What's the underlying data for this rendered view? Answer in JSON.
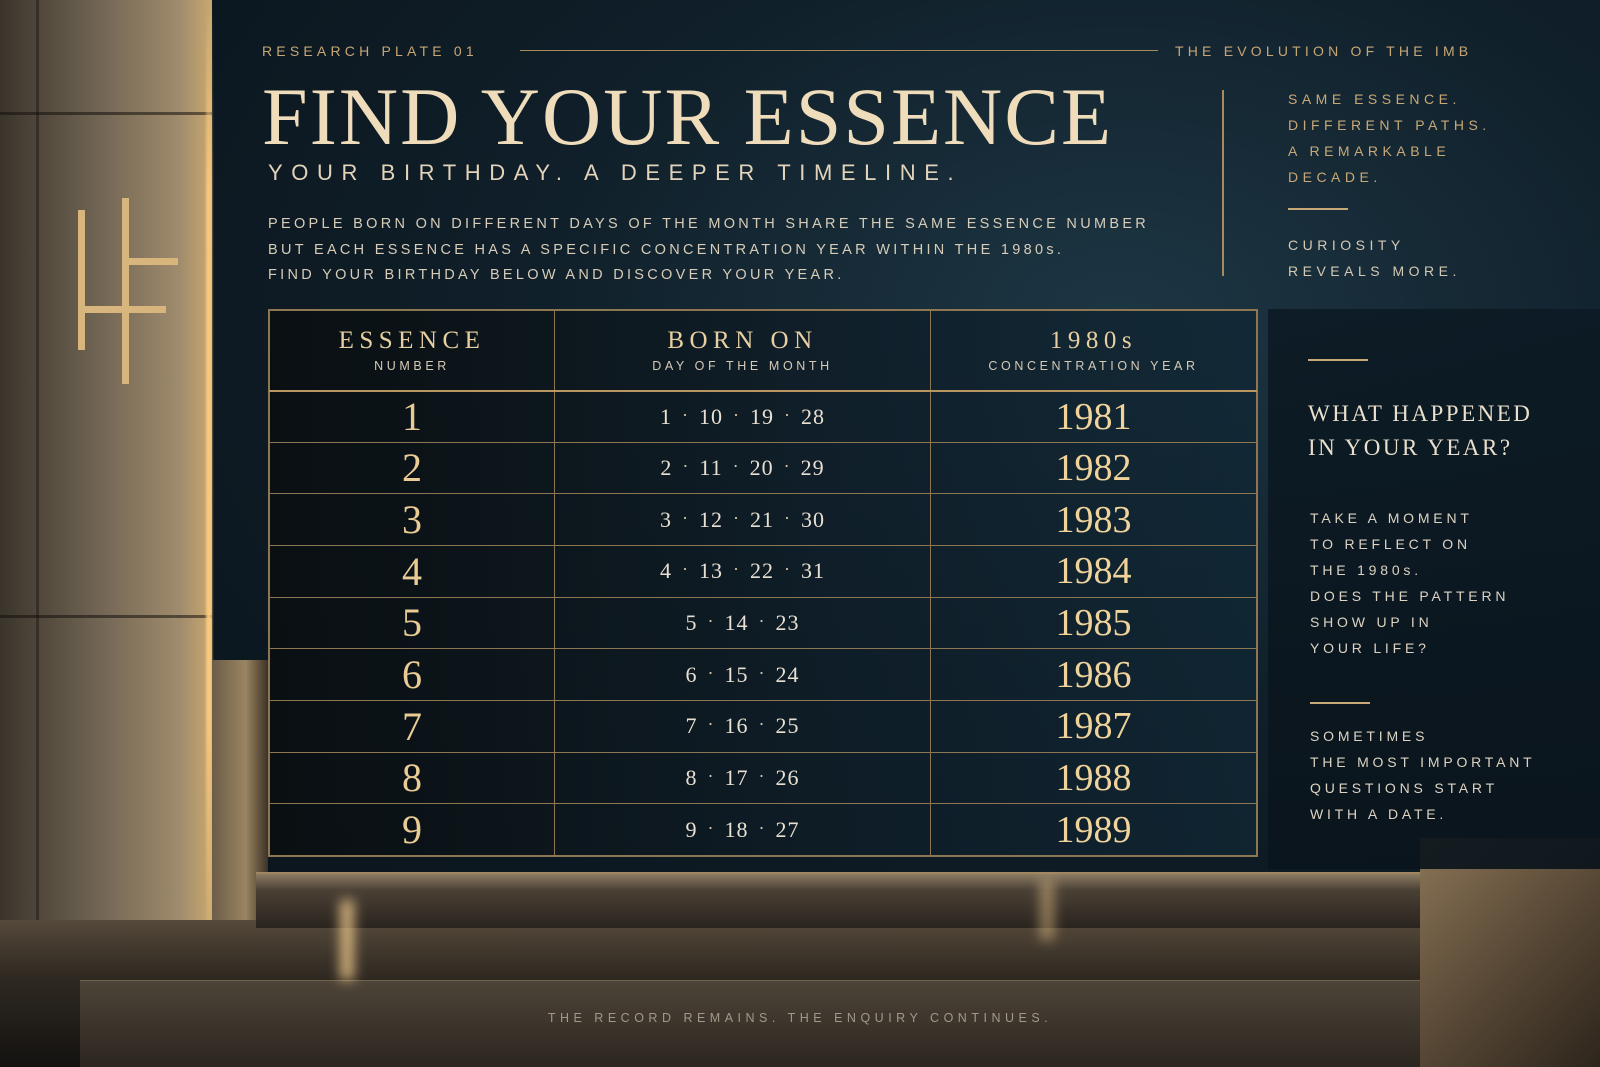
{
  "header": {
    "plate": "RESEARCH PLATE 01",
    "series": "THE EVOLUTION OF THE IMB"
  },
  "title": "FIND YOUR ESSENCE",
  "subtitle": "YOUR BIRTHDAY. A DEEPER TIMELINE.",
  "intro": [
    "PEOPLE BORN ON DIFFERENT DAYS OF THE MONTH SHARE THE SAME ESSENCE NUMBER",
    "BUT EACH ESSENCE HAS A SPECIFIC CONCENTRATION YEAR WITHIN THE 1980s.",
    "FIND YOUR BIRTHDAY BELOW AND DISCOVER YOUR YEAR."
  ],
  "side_top": {
    "lines": [
      "SAME ESSENCE.",
      "DIFFERENT PATHS.",
      "A REMARKABLE",
      "DECADE."
    ],
    "curiosity": [
      "CURIOSITY",
      "REVEALS MORE."
    ]
  },
  "table": {
    "headers": [
      {
        "main": "ESSENCE",
        "sub": "NUMBER"
      },
      {
        "main": "BORN ON",
        "sub": "DAY OF THE MONTH"
      },
      {
        "main": "1980s",
        "sub": "CONCENTRATION YEAR"
      }
    ],
    "rows": [
      {
        "essence": "1",
        "days": [
          "1",
          "10",
          "19",
          "28"
        ],
        "year": "1981"
      },
      {
        "essence": "2",
        "days": [
          "2",
          "11",
          "20",
          "29"
        ],
        "year": "1982"
      },
      {
        "essence": "3",
        "days": [
          "3",
          "12",
          "21",
          "30"
        ],
        "year": "1983"
      },
      {
        "essence": "4",
        "days": [
          "4",
          "13",
          "22",
          "31"
        ],
        "year": "1984"
      },
      {
        "essence": "5",
        "days": [
          "5",
          "14",
          "23"
        ],
        "year": "1985"
      },
      {
        "essence": "6",
        "days": [
          "6",
          "15",
          "24"
        ],
        "year": "1986"
      },
      {
        "essence": "7",
        "days": [
          "7",
          "16",
          "25"
        ],
        "year": "1987"
      },
      {
        "essence": "8",
        "days": [
          "8",
          "17",
          "26"
        ],
        "year": "1988"
      },
      {
        "essence": "9",
        "days": [
          "9",
          "18",
          "27"
        ],
        "year": "1989"
      }
    ],
    "separator": "·"
  },
  "panel": {
    "title": [
      "WHAT HAPPENED",
      "IN YOUR YEAR?"
    ],
    "body": [
      "TAKE A MOMENT",
      "TO REFLECT ON",
      "THE 1980s.",
      "DOES THE PATTERN",
      "SHOW UP IN",
      "YOUR LIFE?"
    ],
    "foot": [
      "SOMETIMES",
      "THE MOST IMPORTANT",
      "QUESTIONS START",
      "WITH A DATE."
    ]
  },
  "footer": "THE RECORD REMAINS. THE ENQUIRY CONTINUES.",
  "logo_icon": "hf-monogram-icon",
  "colors": {
    "gold": "#c9a877",
    "background": "#0f1e28",
    "text": "#e8d9bd"
  }
}
